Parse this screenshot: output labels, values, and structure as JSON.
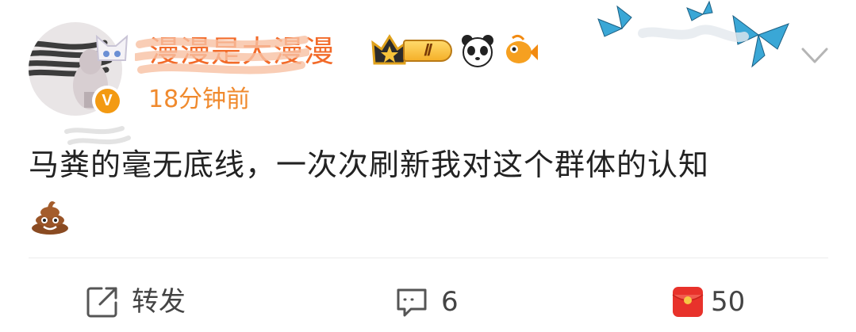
{
  "post": {
    "author": {
      "nickname": "漫漫是大漫漫",
      "vip_level": "Ⅱ"
    },
    "timestamp": "18分钟前",
    "content": {
      "text": "马粪的毫无底线，一次次刷新我对这个群体的认知"
    },
    "actions": {
      "repost_label": "转发",
      "comment_count": "6",
      "like_count": "50"
    }
  },
  "icons": {
    "verified": "verified-badge-icon",
    "crown": "vip-crown-icon",
    "panda": "panda-icon",
    "fish": "goldfish-icon",
    "butterfly": "butterfly-icon",
    "chevron": "chevron-down-icon",
    "poop": "poop-emoji-icon",
    "repost": "repost-icon",
    "comment": "comment-icon",
    "like": "red-envelope-like-icon"
  },
  "colors": {
    "nickname": "#f26b2a",
    "timestamp": "#f08a2e",
    "verified": "#f39a12",
    "like_red": "#e8322b"
  }
}
